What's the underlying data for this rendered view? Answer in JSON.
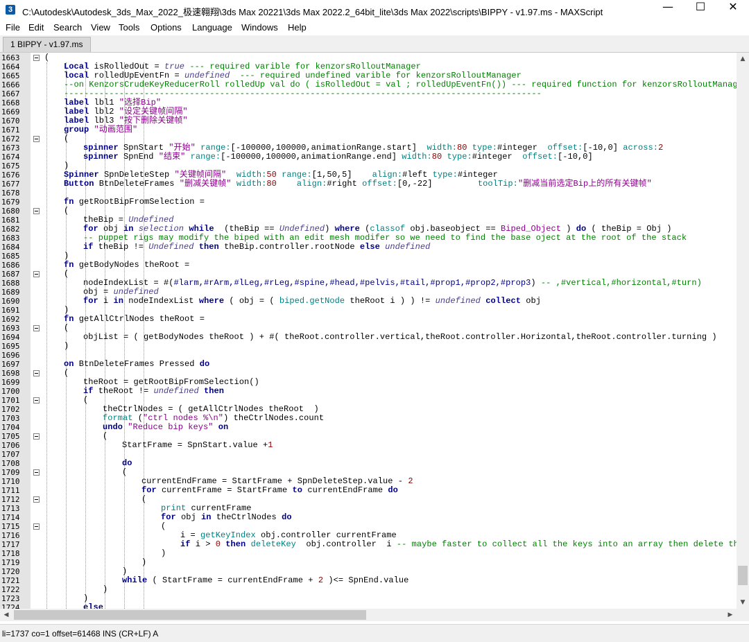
{
  "window": {
    "title": "C:\\Autodesk\\Autodesk_3ds_Max_2022_极速翱翔\\3ds Max 20221\\3ds Max 2022.2_64bit_lite\\3ds Max 2022\\scripts\\BIPPY - v1.97.ms - MAXScript",
    "app_icon_label": "3",
    "minimize": "—",
    "maximize": "☐",
    "close": "✕"
  },
  "menu": [
    "File",
    "Edit",
    "Search",
    "View",
    "Tools",
    "Options",
    "Language",
    "Windows",
    "Help"
  ],
  "tab": {
    "label": "1 BIPPY - v1.97.ms"
  },
  "status": {
    "text": "li=1737 co=1 offset=61468 INS (CR+LF) A"
  },
  "scroll": {
    "up": "▲",
    "down": "▼",
    "left": "◀",
    "right": "▶"
  },
  "lines": [
    {
      "n": "1663",
      "fold": true,
      "segs": [
        [
          "(",
          "fn"
        ]
      ],
      "ind": 0
    },
    {
      "n": "1664",
      "segs": [
        [
          "Local ",
          "kw"
        ],
        [
          "isRolledOut = ",
          "fn"
        ],
        [
          "true",
          "un"
        ],
        [
          " --- required varible for kenzorsRolloutManager",
          "cm"
        ]
      ],
      "ind": 4
    },
    {
      "n": "1665",
      "segs": [
        [
          "local ",
          "kw"
        ],
        [
          "rolledUpEventFn = ",
          "fn"
        ],
        [
          "undefined",
          "un"
        ],
        [
          "  --- required undefined varible for kenzorsRolloutManager",
          "cm"
        ]
      ],
      "ind": 4
    },
    {
      "n": "1666",
      "segs": [
        [
          "--on KenzorsCrudeKeyReducerRoll rolledUp val do ( isRolledOut = val ; rolledUpEventFn()) --- required function for kenzorsRolloutManager",
          "cm"
        ]
      ],
      "ind": 4
    },
    {
      "n": "1667",
      "segs": [
        [
          "-----------------------------------------------------------------------------------------------",
          "cm"
        ]
      ],
      "ind": 4
    },
    {
      "n": "1668",
      "segs": [
        [
          "label ",
          "kw"
        ],
        [
          "lbl1 ",
          "fn"
        ],
        [
          "\"选择Bip\"",
          "str"
        ]
      ],
      "ind": 4
    },
    {
      "n": "1669",
      "segs": [
        [
          "label ",
          "kw"
        ],
        [
          "lbl2 ",
          "fn"
        ],
        [
          "\"设定关键帧间隔\"",
          "str"
        ]
      ],
      "ind": 4
    },
    {
      "n": "1670",
      "segs": [
        [
          "label ",
          "kw"
        ],
        [
          "lbl3 ",
          "fn"
        ],
        [
          "\"按下删除关键帧\"",
          "str"
        ]
      ],
      "ind": 4
    },
    {
      "n": "1671",
      "segs": [
        [
          "group ",
          "kw"
        ],
        [
          "\"动画范围\"",
          "str"
        ]
      ],
      "ind": 4
    },
    {
      "n": "1672",
      "fold": true,
      "segs": [
        [
          "(",
          "fn"
        ]
      ],
      "ind": 4
    },
    {
      "n": "1673",
      "segs": [
        [
          "spinner ",
          "kw"
        ],
        [
          "SpnStart ",
          "fn"
        ],
        [
          "\"开始\" ",
          "str"
        ],
        [
          "range:",
          "nm"
        ],
        [
          "[-100000,100000,animationRange.start]  ",
          "fn"
        ],
        [
          "width:",
          "nm"
        ],
        [
          "80 ",
          "num"
        ],
        [
          "type:",
          "nm"
        ],
        [
          "#integer  ",
          "fn"
        ],
        [
          "offset:",
          "nm"
        ],
        [
          "[-10,0] ",
          "fn"
        ],
        [
          "across:",
          "nm"
        ],
        [
          "2",
          "num"
        ]
      ],
      "ind": 8
    },
    {
      "n": "1674",
      "segs": [
        [
          "spinner ",
          "kw"
        ],
        [
          "SpnEnd ",
          "fn"
        ],
        [
          "\"结束\" ",
          "str"
        ],
        [
          "range:",
          "nm"
        ],
        [
          "[-100000,100000,animationRange.end] ",
          "fn"
        ],
        [
          "width:",
          "nm"
        ],
        [
          "80 ",
          "num"
        ],
        [
          "type:",
          "nm"
        ],
        [
          "#integer  ",
          "fn"
        ],
        [
          "offset:",
          "nm"
        ],
        [
          "[-10,0]",
          "fn"
        ]
      ],
      "ind": 8
    },
    {
      "n": "1675",
      "segs": [
        [
          ")",
          "fn"
        ]
      ],
      "ind": 4
    },
    {
      "n": "1676",
      "segs": [
        [
          "Spinner ",
          "kw"
        ],
        [
          "SpnDeleteStep ",
          "fn"
        ],
        [
          "\"关键帧间隔\"  ",
          "str"
        ],
        [
          "width:",
          "nm"
        ],
        [
          "50 ",
          "num"
        ],
        [
          "range:",
          "nm"
        ],
        [
          "[1,50,5]    ",
          "fn"
        ],
        [
          "align:",
          "nm"
        ],
        [
          "#left ",
          "fn"
        ],
        [
          "type:",
          "nm"
        ],
        [
          "#integer",
          "fn"
        ]
      ],
      "ind": 4
    },
    {
      "n": "1677",
      "segs": [
        [
          "Button ",
          "kw"
        ],
        [
          "BtnDeleteFrames ",
          "fn"
        ],
        [
          "\"删减关键帧\" ",
          "str"
        ],
        [
          "width:",
          "nm"
        ],
        [
          "80    ",
          "num"
        ],
        [
          "align:",
          "nm"
        ],
        [
          "#right ",
          "fn"
        ],
        [
          "offset:",
          "nm"
        ],
        [
          "[0,-22]         ",
          "fn"
        ],
        [
          "toolTip:",
          "nm"
        ],
        [
          "\"删减当前选定Bip上的所有关键帧\"",
          "str"
        ]
      ],
      "ind": 4
    },
    {
      "n": "1678",
      "segs": [],
      "ind": 0
    },
    {
      "n": "1679",
      "segs": [
        [
          "fn ",
          "kw"
        ],
        [
          "getRootBipFromSelection =",
          "fn"
        ]
      ],
      "ind": 4
    },
    {
      "n": "1680",
      "fold": true,
      "segs": [
        [
          "(",
          "fn"
        ]
      ],
      "ind": 4
    },
    {
      "n": "1681",
      "segs": [
        [
          "theBip = ",
          "fn"
        ],
        [
          "Undefined",
          "un"
        ]
      ],
      "ind": 8
    },
    {
      "n": "1682",
      "segs": [
        [
          "for ",
          "kw"
        ],
        [
          "obj ",
          "fn"
        ],
        [
          "in ",
          "kw"
        ],
        [
          "selection ",
          "un"
        ],
        [
          "while ",
          "kw"
        ],
        [
          " (theBip == ",
          "fn"
        ],
        [
          "Undefined",
          "un"
        ],
        [
          ") ",
          "fn"
        ],
        [
          "where ",
          "kw"
        ],
        [
          "(",
          "fn"
        ],
        [
          "classof ",
          "nm"
        ],
        [
          "obj.baseobject == ",
          "fn"
        ],
        [
          "Biped_Object ",
          "str"
        ],
        [
          ") ",
          "fn"
        ],
        [
          "do ",
          "kw"
        ],
        [
          "( theBip = Obj )",
          "fn"
        ]
      ],
      "ind": 8
    },
    {
      "n": "1683",
      "segs": [
        [
          "-- puppet rigs may modify the biped with an edit mesh modifer so we need to find the base oject at the root of the stack",
          "cm"
        ]
      ],
      "ind": 8
    },
    {
      "n": "1684",
      "segs": [
        [
          "if ",
          "kw"
        ],
        [
          "theBip != ",
          "fn"
        ],
        [
          "Undefined ",
          "un"
        ],
        [
          "then ",
          "kw"
        ],
        [
          "theBip.controller.rootNode ",
          "fn"
        ],
        [
          "else ",
          "kw"
        ],
        [
          "undefined",
          "un"
        ]
      ],
      "ind": 8
    },
    {
      "n": "1685",
      "segs": [
        [
          ")",
          "fn"
        ]
      ],
      "ind": 4
    },
    {
      "n": "1686",
      "segs": [
        [
          "fn ",
          "kw"
        ],
        [
          "getBodyNodes theRoot =",
          "fn"
        ]
      ],
      "ind": 4
    },
    {
      "n": "1687",
      "fold": true,
      "segs": [
        [
          "(",
          "fn"
        ]
      ],
      "ind": 4
    },
    {
      "n": "1688",
      "segs": [
        [
          "nodeIndexList = #(",
          "fn"
        ],
        [
          "#larm,#rArm,#lLeg,#rLeg,#spine,#head,#pelvis,#tail,#prop1,#prop2,#prop3",
          "bl"
        ],
        [
          ") ",
          "fn"
        ],
        [
          "-- ,#vertical,#horizontal,#turn)",
          "cm"
        ]
      ],
      "ind": 8
    },
    {
      "n": "1689",
      "segs": [
        [
          "obj = ",
          "fn"
        ],
        [
          "undefined",
          "un"
        ]
      ],
      "ind": 8
    },
    {
      "n": "1690",
      "segs": [
        [
          "for ",
          "kw"
        ],
        [
          "i ",
          "fn"
        ],
        [
          "in ",
          "kw"
        ],
        [
          "nodeIndexList ",
          "fn"
        ],
        [
          "where ",
          "kw"
        ],
        [
          "( obj = ( ",
          "fn"
        ],
        [
          "biped.getNode ",
          "nm"
        ],
        [
          "theRoot i ) ) != ",
          "fn"
        ],
        [
          "undefined ",
          "un"
        ],
        [
          "collect ",
          "kw"
        ],
        [
          "obj",
          "fn"
        ]
      ],
      "ind": 8
    },
    {
      "n": "1691",
      "segs": [
        [
          ")",
          "fn"
        ]
      ],
      "ind": 4
    },
    {
      "n": "1692",
      "segs": [
        [
          "fn ",
          "kw"
        ],
        [
          "getAllCtrlNodes theRoot =",
          "fn"
        ]
      ],
      "ind": 4
    },
    {
      "n": "1693",
      "fold": true,
      "segs": [
        [
          "(",
          "fn"
        ]
      ],
      "ind": 4
    },
    {
      "n": "1694",
      "segs": [
        [
          "objList = ( getBodyNodes theRoot ) + #( theRoot.controller.vertical,theRoot.controller.Horizontal,theRoot.controller.turning )",
          "fn"
        ]
      ],
      "ind": 8
    },
    {
      "n": "1695",
      "segs": [
        [
          ")",
          "fn"
        ]
      ],
      "ind": 4
    },
    {
      "n": "1696",
      "segs": [],
      "ind": 0
    },
    {
      "n": "1697",
      "segs": [
        [
          "on ",
          "kw"
        ],
        [
          "BtnDeleteFrames Pressed ",
          "fn"
        ],
        [
          "do",
          "kw"
        ]
      ],
      "ind": 4
    },
    {
      "n": "1698",
      "fold": true,
      "segs": [
        [
          "(",
          "fn"
        ]
      ],
      "ind": 4
    },
    {
      "n": "1699",
      "segs": [
        [
          "theRoot = getRootBipFromSelection()",
          "fn"
        ]
      ],
      "ind": 8
    },
    {
      "n": "1700",
      "segs": [
        [
          "if ",
          "kw"
        ],
        [
          "theRoot != ",
          "fn"
        ],
        [
          "undefined ",
          "un"
        ],
        [
          "then",
          "kw"
        ]
      ],
      "ind": 8
    },
    {
      "n": "1701",
      "fold": true,
      "segs": [
        [
          "(",
          "fn"
        ]
      ],
      "ind": 8
    },
    {
      "n": "1702",
      "segs": [
        [
          "theCtrlNodes = ( getAllCtrlNodes theRoot  )",
          "fn"
        ]
      ],
      "ind": 12
    },
    {
      "n": "1703",
      "segs": [
        [
          "format ",
          "nm"
        ],
        [
          "(",
          "fn"
        ],
        [
          "\"ctrl nodes %\\n\"",
          "str"
        ],
        [
          ") theCtrlNodes.count",
          "fn"
        ]
      ],
      "ind": 12
    },
    {
      "n": "1704",
      "segs": [
        [
          "undo ",
          "kw"
        ],
        [
          "\"Reduce bip keys\" ",
          "str"
        ],
        [
          "on",
          "kw"
        ]
      ],
      "ind": 12
    },
    {
      "n": "1705",
      "fold": true,
      "segs": [
        [
          "(",
          "fn"
        ]
      ],
      "ind": 12
    },
    {
      "n": "1706",
      "segs": [
        [
          "StartFrame = SpnStart.value +",
          "fn"
        ],
        [
          "1",
          "num"
        ]
      ],
      "ind": 16
    },
    {
      "n": "1707",
      "segs": [],
      "ind": 0
    },
    {
      "n": "1708",
      "segs": [
        [
          "do",
          "kw"
        ]
      ],
      "ind": 16
    },
    {
      "n": "1709",
      "fold": true,
      "segs": [
        [
          "(",
          "fn"
        ]
      ],
      "ind": 16
    },
    {
      "n": "1710",
      "segs": [
        [
          "currentEndFrame = StartFrame + SpnDeleteStep.value - ",
          "fn"
        ],
        [
          "2",
          "num"
        ]
      ],
      "ind": 20
    },
    {
      "n": "1711",
      "segs": [
        [
          "for ",
          "kw"
        ],
        [
          "currentFrame = StartFrame ",
          "fn"
        ],
        [
          "to ",
          "kw"
        ],
        [
          "currentEndFrame ",
          "fn"
        ],
        [
          "do",
          "kw"
        ]
      ],
      "ind": 20
    },
    {
      "n": "1712",
      "fold": true,
      "segs": [
        [
          "(",
          "fn"
        ]
      ],
      "ind": 20
    },
    {
      "n": "1713",
      "segs": [
        [
          "print ",
          "nm"
        ],
        [
          "currentFrame",
          "fn"
        ]
      ],
      "ind": 24
    },
    {
      "n": "1714",
      "segs": [
        [
          "for ",
          "kw"
        ],
        [
          "obj ",
          "fn"
        ],
        [
          "in ",
          "kw"
        ],
        [
          "theCtrlNodes ",
          "fn"
        ],
        [
          "do",
          "kw"
        ]
      ],
      "ind": 24
    },
    {
      "n": "1715",
      "fold": true,
      "segs": [
        [
          "(",
          "fn"
        ]
      ],
      "ind": 24
    },
    {
      "n": "1716",
      "segs": [
        [
          "i = ",
          "fn"
        ],
        [
          "getKeyIndex ",
          "nm"
        ],
        [
          "obj.controller currentFrame",
          "fn"
        ]
      ],
      "ind": 28
    },
    {
      "n": "1717",
      "segs": [
        [
          "if ",
          "kw"
        ],
        [
          "i > ",
          "fn"
        ],
        [
          "0 ",
          "num"
        ],
        [
          "then ",
          "kw"
        ],
        [
          "deleteKey ",
          "nm"
        ],
        [
          " obj.controller  i ",
          "fn"
        ],
        [
          "-- maybe faster to collect all the keys into an array then delete them",
          "cm"
        ]
      ],
      "ind": 28
    },
    {
      "n": "1718",
      "segs": [
        [
          ")",
          "fn"
        ]
      ],
      "ind": 24
    },
    {
      "n": "1719",
      "segs": [
        [
          ")",
          "fn"
        ]
      ],
      "ind": 20
    },
    {
      "n": "1720",
      "segs": [
        [
          ")",
          "fn"
        ]
      ],
      "ind": 16
    },
    {
      "n": "1721",
      "segs": [
        [
          "while ",
          "kw"
        ],
        [
          "( StartFrame = currentEndFrame + ",
          "fn"
        ],
        [
          "2 ",
          "num"
        ],
        [
          ")<= SpnEnd.value",
          "fn"
        ]
      ],
      "ind": 16
    },
    {
      "n": "1722",
      "segs": [
        [
          ")",
          "fn"
        ]
      ],
      "ind": 12
    },
    {
      "n": "1723",
      "segs": [
        [
          ")",
          "fn"
        ]
      ],
      "ind": 8
    },
    {
      "n": "1724",
      "segs": [
        [
          "else",
          "kw"
        ]
      ],
      "ind": 8
    }
  ]
}
